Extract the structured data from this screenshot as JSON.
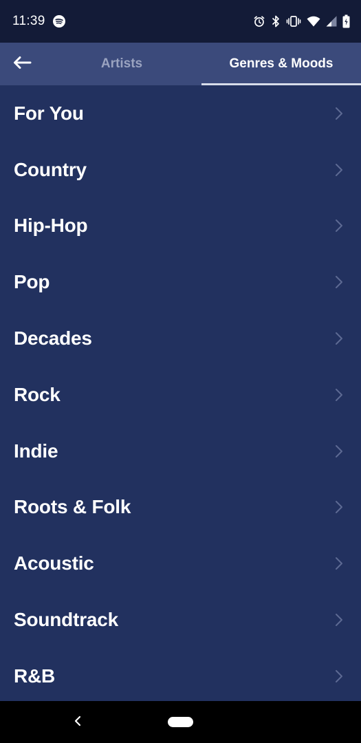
{
  "status_bar": {
    "time": "11:39",
    "app_icon": "spotify-icon",
    "icons": [
      "alarm-icon",
      "bluetooth-icon",
      "vibrate-icon",
      "wifi-icon",
      "signal-icon",
      "battery-icon"
    ]
  },
  "header": {
    "back_icon": "arrow-left-icon",
    "tabs": [
      {
        "label": "Artists",
        "active": false
      },
      {
        "label": "Genres & Moods",
        "active": true
      }
    ]
  },
  "genres": [
    {
      "label": "For You"
    },
    {
      "label": "Country"
    },
    {
      "label": "Hip-Hop"
    },
    {
      "label": "Pop"
    },
    {
      "label": "Decades"
    },
    {
      "label": "Rock"
    },
    {
      "label": "Indie"
    },
    {
      "label": "Roots & Folk"
    },
    {
      "label": "Acoustic"
    },
    {
      "label": "Soundtrack"
    },
    {
      "label": "R&B"
    }
  ],
  "nav_bar": {
    "back_icon": "nav-back-icon",
    "home_icon": "home-pill-icon"
  },
  "colors": {
    "background": "#22315f",
    "header": "#3b4a7b",
    "status_bar": "#131b37",
    "inactive_tab": "#9aa3c0",
    "text": "#ffffff"
  }
}
